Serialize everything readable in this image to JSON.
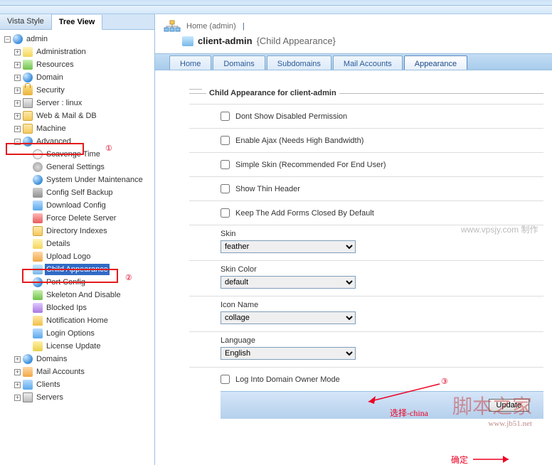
{
  "tabs": {
    "vista": "Vista Style",
    "tree": "Tree View"
  },
  "tree": {
    "root": "admin",
    "administration": "Administration",
    "resources": "Resources",
    "domain": "Domain",
    "security": "Security",
    "server": "Server : linux",
    "webmail": "Web & Mail & DB",
    "machine": "Machine",
    "advanced": "Advanced",
    "adv": {
      "scavenge": "Scavenge Time",
      "general": "General Settings",
      "maintenance": "System Under Maintenance",
      "backup": "Config Self Backup",
      "download": "Download Config",
      "forcedel": "Force Delete Server",
      "dirindex": "Directory Indexes",
      "details": "Details",
      "uploadlogo": "Upload Logo",
      "childapp": "Child Appearance",
      "portconfig": "Port Config",
      "skeleton": "Skeleton And Disable",
      "blocked": "Blocked Ips",
      "notif": "Notification Home",
      "login": "Login Options",
      "license": "License Update"
    },
    "domains": "Domains",
    "mailacc": "Mail Accounts",
    "clients": "Clients",
    "servers": "Servers"
  },
  "breadcrumb": {
    "home": "Home",
    "home_sub": "(admin)",
    "sep": "|",
    "title": "client-admin",
    "title_sub": "{Child Appearance}"
  },
  "navtabs": {
    "home": "Home",
    "domains": "Domains",
    "subdomains": "Subdomains",
    "mail": "Mail Accounts",
    "appearance": "Appearance"
  },
  "form": {
    "legend": "Child Appearance for client-admin",
    "cb1": "Dont Show Disabled Permission",
    "cb2": "Enable Ajax (Needs High Bandwidth)",
    "cb3": "Simple Skin (Recommended For End User)",
    "cb4": "Show Thin Header",
    "cb5": "Keep The Add Forms Closed By Default",
    "skin_label": "Skin",
    "skin_value": "feather",
    "skincolor_label": "Skin Color",
    "skincolor_value": "default",
    "icon_label": "Icon Name",
    "icon_value": "collage",
    "lang_label": "Language",
    "lang_value": "English",
    "cb6": "Log Into Domain Owner Mode",
    "update": "Update"
  },
  "annotations": {
    "num1": "①",
    "num2": "②",
    "num3": "③",
    "select_china": "选择-china",
    "confirm": "确定",
    "watermark": "www.vpsjy.com 制作",
    "brand": "脚本之家",
    "brand_url": "www.jb51.net"
  }
}
